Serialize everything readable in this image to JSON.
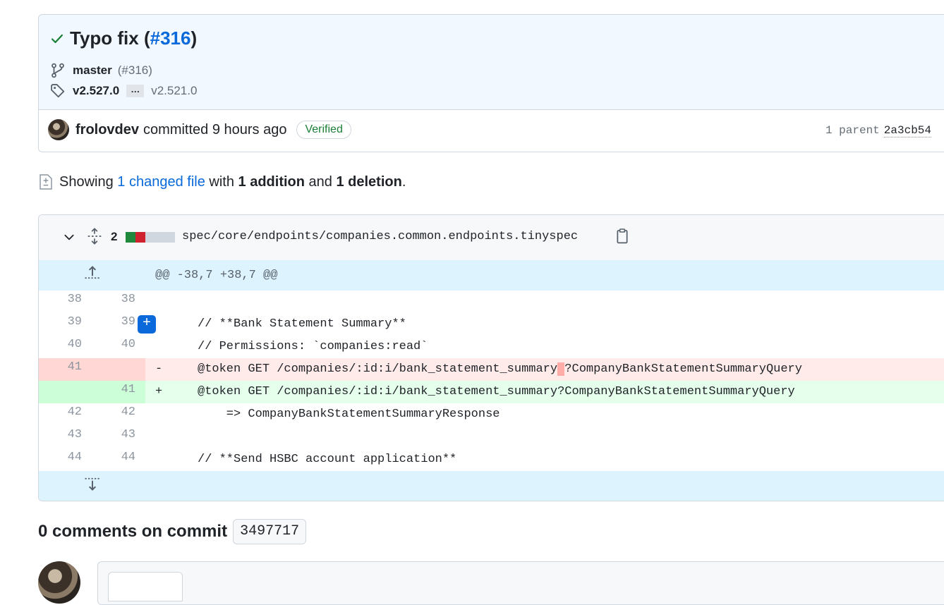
{
  "commit": {
    "title_prefix": "Typo fix (",
    "pr_link": "#316",
    "title_suffix": ")",
    "branch": "master",
    "branch_pr": "(#316)",
    "tag_latest": "v2.527.0",
    "tag_ellipsis": "…",
    "tag_oldest": "v2.521.0",
    "author": "frolovdev",
    "committed_text": "committed 9 hours ago",
    "verified_label": "Verified",
    "parent_label": "1 parent",
    "parent_sha": "2a3cb54"
  },
  "summary": {
    "showing": "Showing",
    "changed_files": "1 changed file",
    "with": "with",
    "additions": "1 addition",
    "and": "and",
    "deletions": "1 deletion",
    "period": "."
  },
  "file": {
    "changes_count": "2",
    "path": "spec/core/endpoints/companies.common.endpoints.tinyspec",
    "diffstat_colors": [
      "#1f883d",
      "#cf222e",
      "#d0d7de",
      "#d0d7de",
      "#d0d7de"
    ]
  },
  "diff": {
    "hunk_header": "@@ -38,7 +38,7 @@",
    "lines": [
      {
        "type": "ctx",
        "old": "38",
        "new": "38",
        "marker": "",
        "code": ""
      },
      {
        "type": "ctx",
        "old": "39",
        "new": "39",
        "marker": "",
        "code": "// **Bank Statement Summary**"
      },
      {
        "type": "ctx",
        "old": "40",
        "new": "40",
        "marker": "",
        "code": "// Permissions: `companies:read`"
      },
      {
        "type": "del",
        "old": "41",
        "new": "",
        "marker": "-",
        "code_before": "@token GET /companies/:id:i/bank_statement_summary",
        "code_hl": " ",
        "code_after": "?CompanyBankStatementSummaryQuery"
      },
      {
        "type": "add",
        "old": "",
        "new": "41",
        "marker": "+",
        "code": "@token GET /companies/:id:i/bank_statement_summary?CompanyBankStatementSummaryQuery"
      },
      {
        "type": "ctx",
        "old": "42",
        "new": "42",
        "marker": "",
        "code": "    => CompanyBankStatementSummaryResponse"
      },
      {
        "type": "ctx",
        "old": "43",
        "new": "43",
        "marker": "",
        "code": ""
      },
      {
        "type": "ctx",
        "old": "44",
        "new": "44",
        "marker": "",
        "code": "// **Send HSBC account application**"
      }
    ]
  },
  "comments": {
    "heading": "0 comments on commit",
    "sha": "3497717"
  },
  "icons": {
    "check": "check-icon",
    "branch": "git-branch-icon",
    "tag": "tag-icon",
    "file_diff": "file-diff-icon",
    "chevron": "chevron-down-icon",
    "expand_all": "unfold-icon",
    "copy": "copy-icon",
    "expand_up": "fold-up-icon",
    "expand_down": "fold-down-icon",
    "add_comment": "plus-icon"
  }
}
